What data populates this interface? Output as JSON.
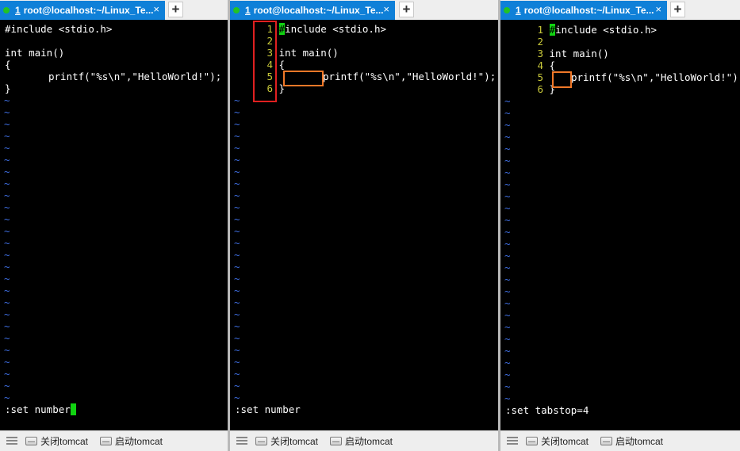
{
  "panes": [
    {
      "tab": {
        "number": "1",
        "title": "root@localhost:~/Linux_Te...",
        "close": "×"
      },
      "new_tab": "+",
      "command": ":set number",
      "bottom": {
        "button1": "关闭tomcat",
        "button2": "启动tomcat"
      }
    },
    {
      "tab": {
        "number": "1",
        "title": "root@localhost:~/Linux_Te...",
        "close": "×"
      },
      "new_tab": "+",
      "line_numbers": [
        "1",
        "2",
        "3",
        "4",
        "5",
        "6"
      ],
      "command": ":set number",
      "bottom": {
        "button1": "关闭tomcat",
        "button2": "启动tomcat"
      }
    },
    {
      "tab": {
        "number": "1",
        "title": "root@localhost:~/Linux_Te...",
        "close": "×"
      },
      "new_tab": "+",
      "line_numbers": [
        "1",
        "2",
        "3",
        "4",
        "5",
        "6"
      ],
      "command": ":set tabstop=4",
      "bottom": {
        "button1": "关闭tomcat",
        "button2": "启动tomcat"
      }
    }
  ],
  "code": {
    "line1": "#include <stdio.h>",
    "line1_first": "#",
    "line1_rest": "include <stdio.h>",
    "line2": "",
    "line3": "int main()",
    "line4": "{",
    "line5": "printf(\"%s\\n\",\"HelloWorld!\");",
    "line6": "}"
  },
  "empty_marker": "~",
  "colors": {
    "tab_active": "#0f80d8",
    "cursor": "#11d311",
    "tilde": "#3e6de0",
    "line_number": "#c8c83a",
    "highlight_red": "#e02020",
    "highlight_orange": "#f07828"
  }
}
